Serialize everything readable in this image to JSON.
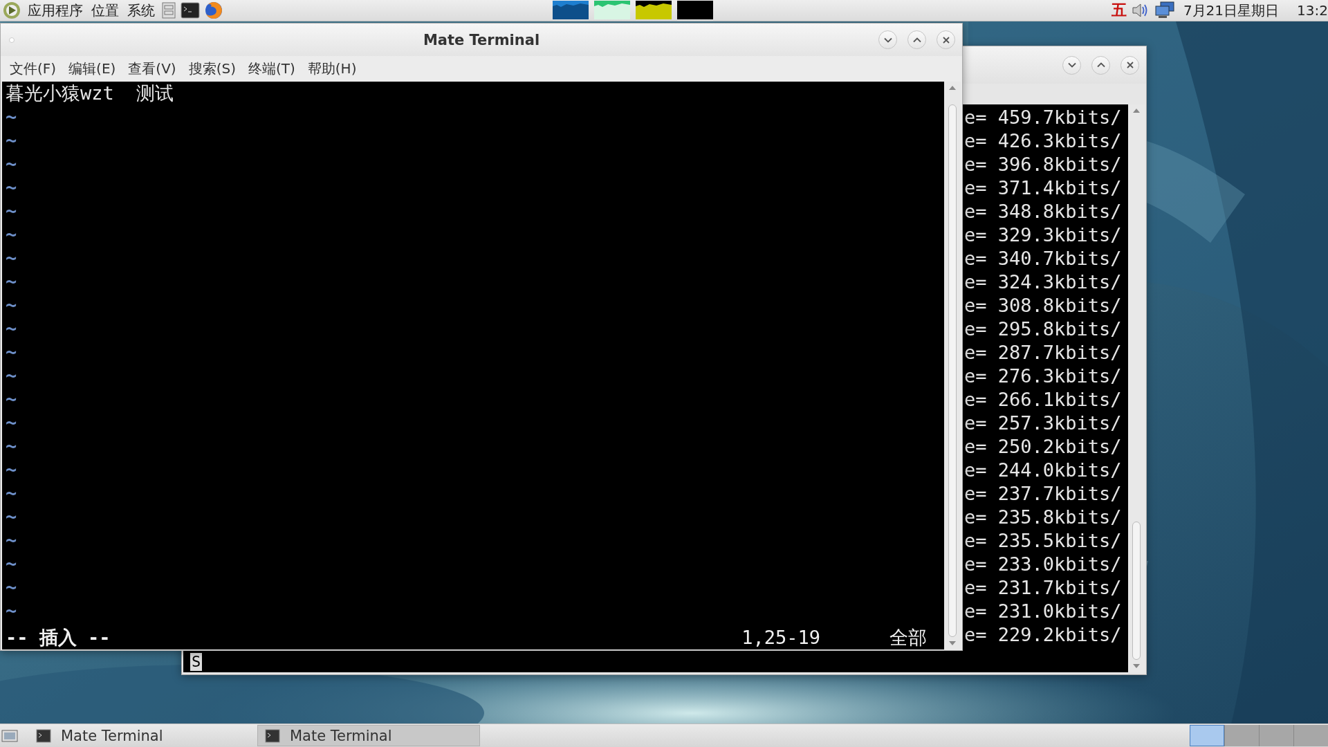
{
  "top_panel": {
    "menus": [
      "应用程序",
      "位置",
      "系统"
    ],
    "input_method": "五",
    "clock_date": "7月21日星期日",
    "clock_time": "13:2"
  },
  "main_window": {
    "title": "Mate Terminal",
    "menus": [
      "文件(F)",
      "编辑(E)",
      "查看(V)",
      "搜索(S)",
      "终端(T)",
      "帮助(H)"
    ],
    "buffer_lines": [
      "暮光小猿wzt  测试"
    ],
    "tilde_lines": [
      "~",
      "~",
      "~",
      "~",
      "~",
      "~",
      "~",
      "~",
      "~",
      "~",
      "~",
      "~",
      "~",
      "~",
      "~",
      "~",
      "~",
      "~",
      "~",
      "~",
      "~",
      "~"
    ],
    "status_mode": "-- 插入 --",
    "status_position": "1,25-19",
    "status_scroll": "全部"
  },
  "back_window": {
    "output_lines": [
      "e= 459.7kbits/",
      "e= 426.3kbits/",
      "e= 396.8kbits/",
      "e= 371.4kbits/",
      "e= 348.8kbits/",
      "e= 329.3kbits/",
      "e= 340.7kbits/",
      "e= 324.3kbits/",
      "e= 308.8kbits/",
      "e= 295.8kbits/",
      "e= 287.7kbits/",
      "e= 276.3kbits/",
      "e= 266.1kbits/",
      "e= 257.3kbits/",
      "e= 250.2kbits/",
      "e= 244.0kbits/",
      "e= 237.7kbits/",
      "e= 235.8kbits/",
      "e= 235.5kbits/",
      "e= 233.0kbits/",
      "e= 231.7kbits/",
      "e= 231.0kbits/",
      "e= 229.2kbits/"
    ],
    "prompt": "S"
  },
  "taskbar": {
    "tasks": [
      {
        "label": "Mate Terminal",
        "selected": false
      },
      {
        "label": "Mate Terminal",
        "selected": true
      }
    ],
    "workspaces": [
      {
        "selected": true
      },
      {
        "selected": false
      },
      {
        "selected": false
      },
      {
        "selected": false
      }
    ]
  }
}
